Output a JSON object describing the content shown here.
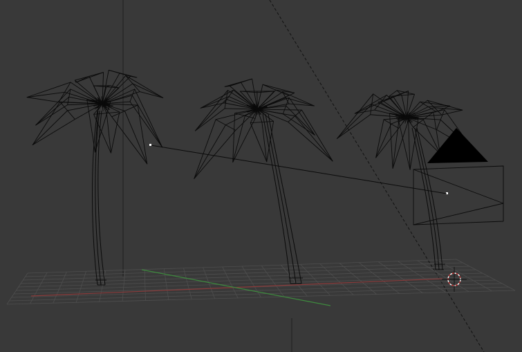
{
  "viewport": {
    "mode": "wireframe",
    "background_color": "#393939",
    "wire_color": "#0a0a0a",
    "grid_color": "#4e4e4e",
    "x_axis_color": "#8a3a3a",
    "y_axis_color": "#3e8a3e",
    "selection_color": "#ffffff",
    "cursor_color": "#c83232"
  },
  "scene": {
    "objects": [
      {
        "name": "palm-tree",
        "kind": "mesh"
      },
      {
        "name": "palm-tree",
        "kind": "mesh"
      },
      {
        "name": "palm-tree",
        "kind": "mesh"
      },
      {
        "name": "camera",
        "kind": "camera"
      }
    ],
    "icons": [
      "camera-icon",
      "3d-cursor-icon",
      "origin-point-icon"
    ]
  }
}
